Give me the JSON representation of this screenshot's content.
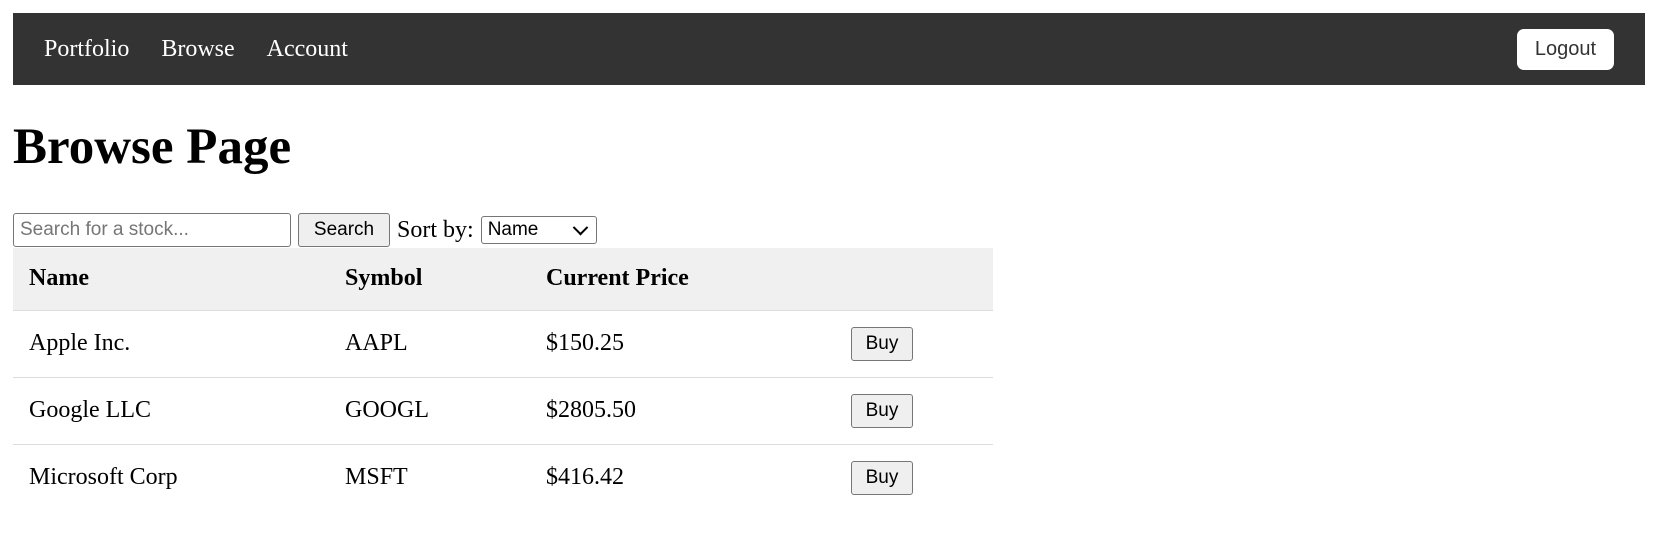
{
  "nav": {
    "links": [
      "Portfolio",
      "Browse",
      "Account"
    ],
    "logout_label": "Logout",
    "background_color": "#333333"
  },
  "page": {
    "title": "Browse Page"
  },
  "controls": {
    "search_placeholder": "Search for a stock...",
    "search_value": "",
    "search_label": "Search",
    "sort_label": "Sort by:",
    "sort_selected": "Name"
  },
  "table": {
    "headers": [
      "Name",
      "Symbol",
      "Current Price",
      ""
    ],
    "rows": [
      {
        "name": "Apple Inc.",
        "symbol": "AAPL",
        "price": "$150.25",
        "action": "Buy"
      },
      {
        "name": "Google LLC",
        "symbol": "GOOGL",
        "price": "$2805.50",
        "action": "Buy"
      },
      {
        "name": "Microsoft Corp",
        "symbol": "MSFT",
        "price": "$416.42",
        "action": "Buy"
      }
    ]
  },
  "icons": {
    "sort_dropdown": "chevron-down-icon"
  }
}
